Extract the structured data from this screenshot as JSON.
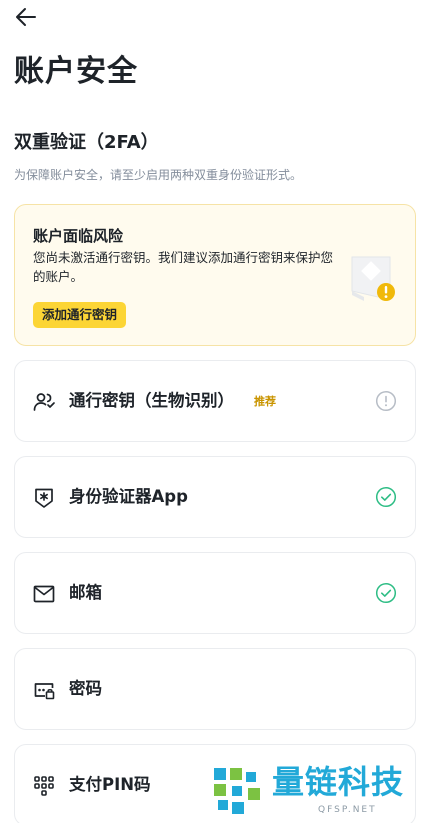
{
  "header": {
    "back_icon": "arrow-left-icon",
    "title": "账户安全"
  },
  "two_fa": {
    "title": "双重验证（2FA）",
    "description": "为保障账户安全，请至少启用两种双重身份验证形式。"
  },
  "risk_card": {
    "title": "账户面临风险",
    "description": "您尚未激活通行密钥。我们建议添加通行密钥来保护您的账户。",
    "button_label": "添加通行密钥",
    "accent_color": "#fcd535",
    "warning_color": "#f0b90b"
  },
  "methods": [
    {
      "label": "通行密钥（生物识别）",
      "badge": "推荐",
      "icon": "users-icon",
      "status": "not-enabled",
      "status_icon": "exclamation-circle-icon"
    },
    {
      "label": "身份验证器App",
      "icon": "authenticator-shield-icon",
      "status": "enabled",
      "status_icon": "check-circle-icon"
    },
    {
      "label": "邮箱",
      "icon": "mail-icon",
      "status": "enabled",
      "status_icon": "check-circle-icon"
    },
    {
      "label": "密码",
      "icon": "password-lock-icon"
    },
    {
      "label": "支付PIN码",
      "icon": "pin-keypad-icon"
    }
  ],
  "colors": {
    "enabled": "#2ebd85",
    "muted": "#b7bdc6",
    "badge": "#c99400"
  },
  "watermark": {
    "name": "量链科技",
    "domain": "QFSP.NET"
  }
}
